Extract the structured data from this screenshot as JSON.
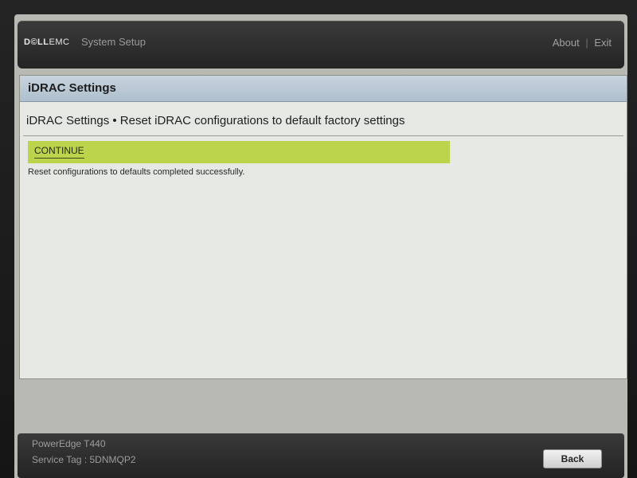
{
  "header": {
    "logo_main": "D©LL",
    "logo_sub": "EMC",
    "app_title": "System Setup",
    "about_label": "About",
    "separator": "|",
    "exit_label": "Exit"
  },
  "section": {
    "title": "iDRAC Settings"
  },
  "page": {
    "heading": "iDRAC Settings • Reset iDRAC configurations to default factory settings",
    "continue_label": "CONTINUE",
    "status_message": "Reset configurations to defaults completed successfully."
  },
  "footer": {
    "model": "PowerEdge T440",
    "service_tag": "Service Tag : 5DNMQP2",
    "back_label": "Back"
  },
  "colors": {
    "continue_bar": "#bcd44c",
    "section_header": "#b8c7d4",
    "panel_background": "#e6e8e3",
    "topbar": "#2f2f2f"
  }
}
